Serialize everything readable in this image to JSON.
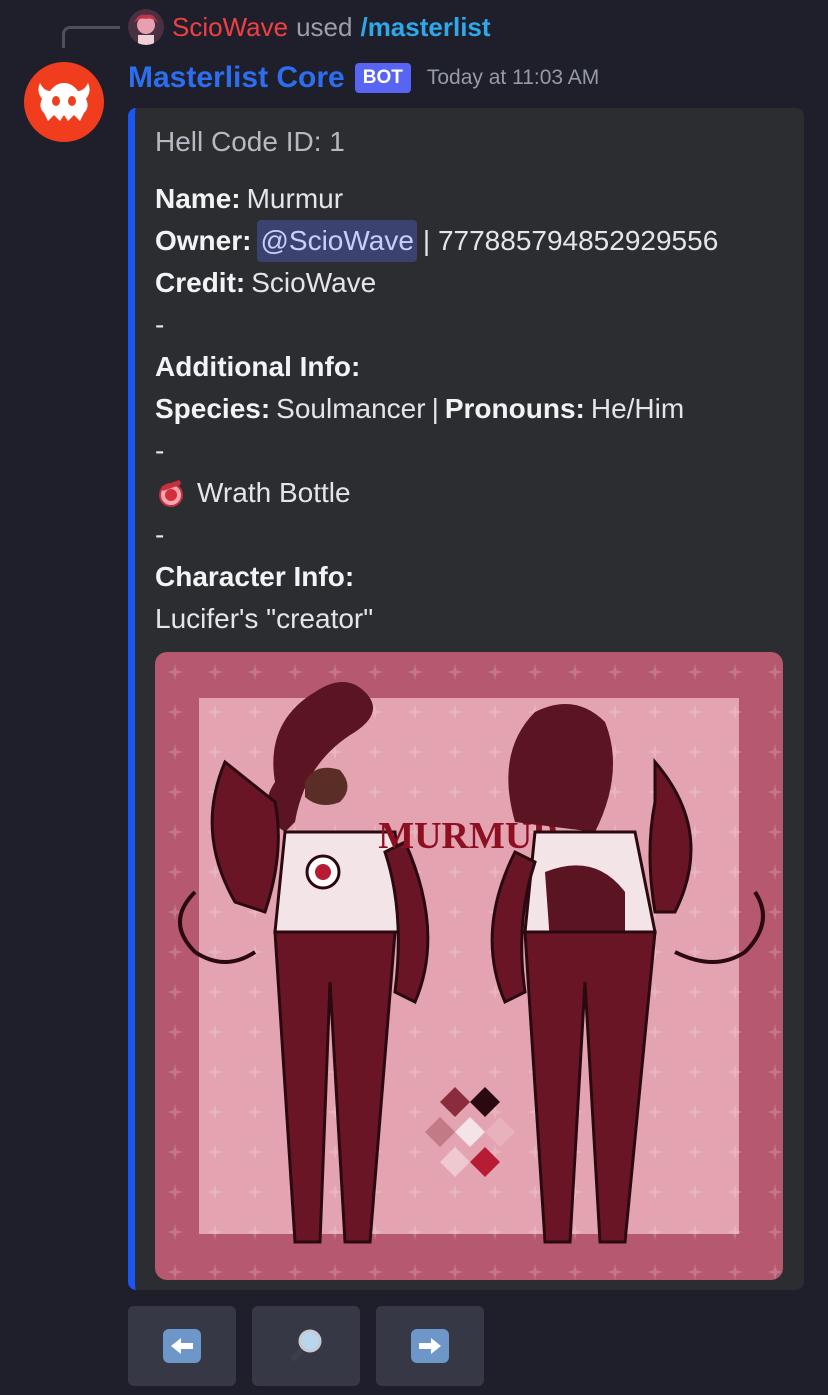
{
  "reply": {
    "user": "ScioWave",
    "used_text": "used",
    "command": "/masterlist"
  },
  "message": {
    "bot_name": "Masterlist Core",
    "badge": "BOT",
    "timestamp": "Today at 11:03 AM",
    "embed": {
      "accent_color": "#1b55f2",
      "title": "Hell Code ID: 1",
      "name_label": "Name:",
      "name_value": "Murmur",
      "owner_label": "Owner:",
      "owner_mention": "@ScioWave",
      "owner_id": "| 777885794852929556",
      "credit_label": "Credit:",
      "credit_value": "ScioWave",
      "dash": "-",
      "additional_info_label": "Additional Info:",
      "species_label": "Species:",
      "species_value": "Soulmancer",
      "pronouns_sep": "|",
      "pronouns_label": "Pronouns:",
      "pronouns_value": "He/Him",
      "item_icon": "wrath-bottle-icon",
      "item_label": "Wrath Bottle",
      "character_info_label": "Character Info:",
      "character_info_value": "Lucifer's \"creator\"",
      "image_text": "MURMUR"
    }
  },
  "buttons": [
    {
      "icon": "arrow-left-icon"
    },
    {
      "icon": "magnifier-icon"
    },
    {
      "icon": "arrow-right-icon"
    }
  ]
}
